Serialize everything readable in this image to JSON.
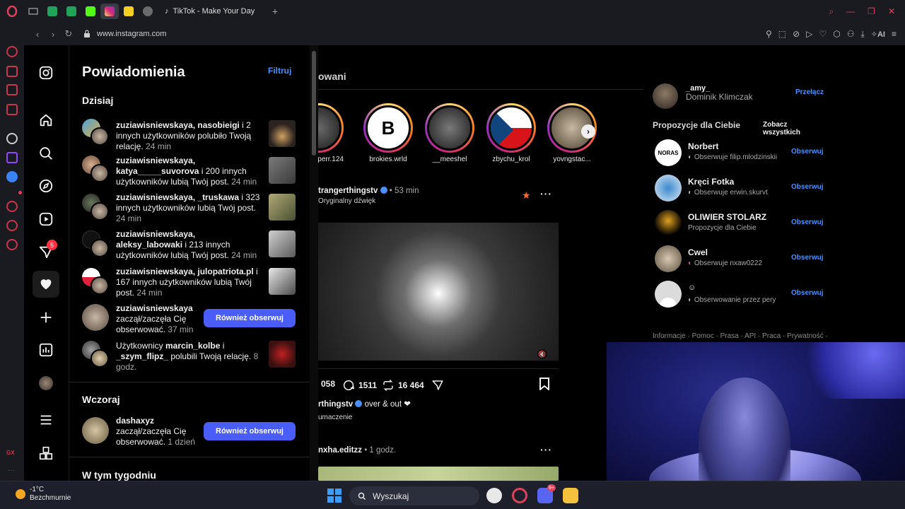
{
  "browser": {
    "active_tab_title": "TikTok - Make Your Day",
    "url": "www.instagram.com",
    "add_tab_label": "+",
    "ai_label": "AI"
  },
  "opera_sidebar": {
    "gx_label": "GX",
    "badge_count": "5"
  },
  "ig_nav": {
    "notif_badge": "5"
  },
  "notifications": {
    "title": "Powiadomienia",
    "filter_label": "Filtruj",
    "sections": {
      "today": "Dzisiaj",
      "yesterday": "Wczoraj",
      "this_week": "W tym tygodniu"
    },
    "items": [
      {
        "user": "zuziawisniewskaya, nasobieigi",
        "text": " i 2 innych użytkowników polubiło Twoją relację.",
        "time": "24 min"
      },
      {
        "user": "zuziawisniewskaya, katya_____suvorova",
        "text": " i 200 innych użytkowników lubią Twój post.",
        "time": "24 min"
      },
      {
        "user": "zuziawisniewskaya, _truskawa",
        "text": " i 323 innych użytkowników lubią Twój post.",
        "time": "24 min"
      },
      {
        "user": "zuziawisniewskaya, aleksy_labowaki",
        "text": " i 213 innych użytkowników lubią Twój post.",
        "time": "24 min"
      },
      {
        "user": "zuziawisniewskaya, julopatriota.pl",
        "text": " i 167 innych użytkowników lubią Twój post.",
        "time": "24 min"
      },
      {
        "user": "zuziawisniewskaya",
        "text": " zaczął/zaczęła Cię obserwować.",
        "time": "37 min",
        "button": "Również obserwuj"
      },
      {
        "prefix": "Użytkownicy ",
        "user": "marcin_kolbe",
        "mid": " i ",
        "user2": "_szym_flipz_",
        "text": " polubili Twoją relację.",
        "time": "8 godz."
      },
      {
        "user": "dashaxyz",
        "text": " zaczął/zaczęła Cię obserwować.",
        "time": "1 dzień",
        "button": "Również obserwuj"
      }
    ]
  },
  "feed": {
    "title_fragment": "owani",
    "stories": [
      {
        "name": "cperr.124"
      },
      {
        "name": "brokies.wrld"
      },
      {
        "name": "__meeshel"
      },
      {
        "name": "zbychu_krol"
      },
      {
        "name": "yovngstac..."
      }
    ],
    "post": {
      "user": "trangerthingstv",
      "time": "53 min",
      "audio": "Oryginalny dźwięk",
      "likes": "058",
      "comments": "1511",
      "reposts": "16 464",
      "caption_user": "rthingstv",
      "caption_text": "over & out ❤",
      "translate": "umaczenie"
    },
    "post2": {
      "user": "nxha.editzz",
      "time": "1 godz."
    }
  },
  "right": {
    "me_user": "_amy_",
    "me_name": "Dominik Klimczak",
    "switch_label": "Przełącz",
    "suggestions_title": "Propozycje dla Ciebie",
    "see_all": "Zobacz wszystkich",
    "suggestions": [
      {
        "user": "Norbert",
        "sub": "Obserwuje filip.mlodzinskii",
        "follow": "Obserwuj"
      },
      {
        "user": "Kręci Fotka",
        "sub": "Obserwuje erwin.skurvt",
        "follow": "Obserwuj"
      },
      {
        "user": "OLIWIER STOLARZ",
        "sub": "Propozycje dla Ciebie",
        "follow": "Obserwuj"
      },
      {
        "user": "Cwel",
        "sub": "Obserwuje nxaw0222",
        "follow": "Obserwuj"
      },
      {
        "user": "",
        "sub": "Obserwowanie przez pery",
        "follow": "Obserwuj"
      }
    ],
    "footer": "Informacje · Pomoc · Prasa · API · Praca · Prywatność ·"
  },
  "taskbar": {
    "temp": "-1°C",
    "weather": "Bezchmurnie",
    "search_placeholder": "Wyszukaj",
    "discord_badge": "9+"
  }
}
